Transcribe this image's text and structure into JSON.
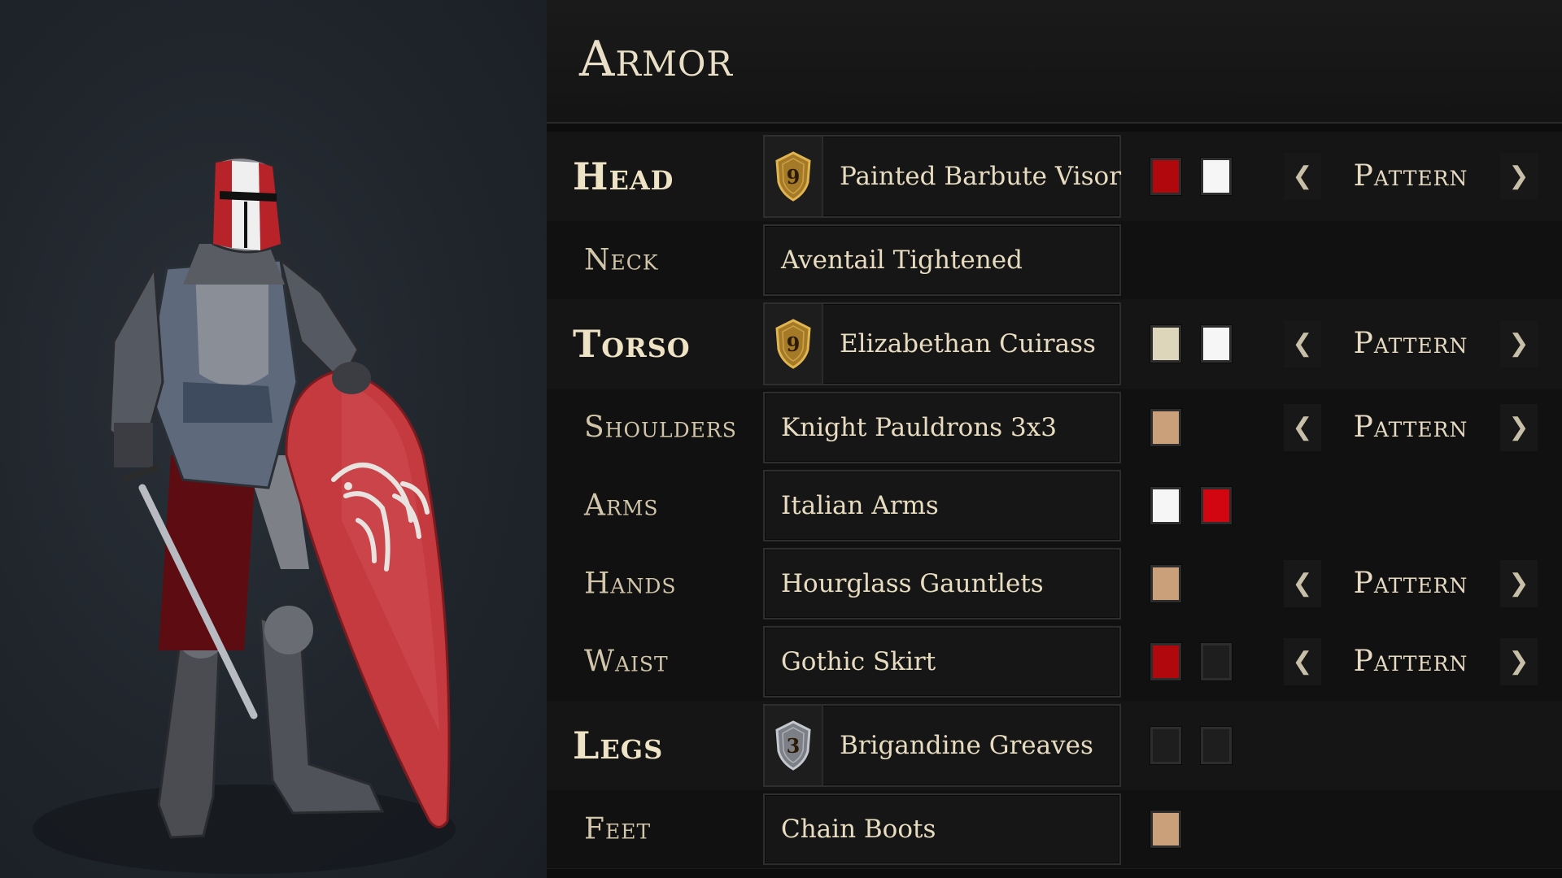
{
  "header": {
    "title": "Armor"
  },
  "pattern_label": "Pattern",
  "slots": [
    {
      "label": "Head",
      "item": "Painted Barbute Visor",
      "tier": "9",
      "colors": [
        "#b0080d",
        "#f6f6f6"
      ],
      "pattern": true
    },
    {
      "label": "Neck",
      "item": "Aventail Tightened"
    },
    {
      "label": "Torso",
      "item": "Elizabethan Cuirass",
      "tier": "9",
      "colors": [
        "#ddd6bb",
        "#f6f6f6"
      ],
      "pattern": true
    },
    {
      "label": "Shoulders",
      "item": "Knight Pauldrons 3x3",
      "colors": [
        "#c9a07a"
      ],
      "pattern": true
    },
    {
      "label": "Arms",
      "item": "Italian Arms",
      "colors": [
        "#f6f6f6",
        "#d10610"
      ]
    },
    {
      "label": "Hands",
      "item": "Hourglass Gauntlets",
      "colors": [
        "#c9a07a"
      ],
      "pattern": true
    },
    {
      "label": "Waist",
      "item": "Gothic Skirt",
      "colors": [
        "#b0080d",
        "#1e1e1e"
      ],
      "pattern": true
    },
    {
      "label": "Legs",
      "item": "Brigandine Greaves",
      "tier": "3",
      "colors": [
        "#1e1e1e",
        "#1e1e1e"
      ]
    },
    {
      "label": "Feet",
      "item": "Chain Boots",
      "colors": [
        "#c9a07a"
      ]
    }
  ]
}
